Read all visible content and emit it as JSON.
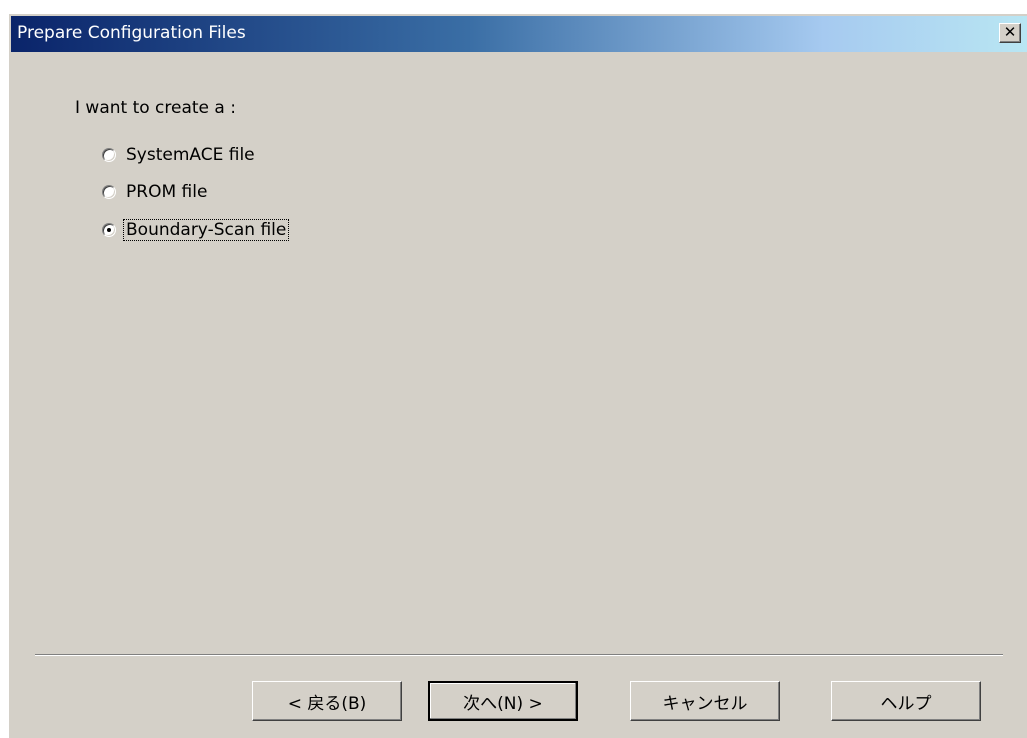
{
  "window": {
    "title": "Prepare Configuration Files",
    "close_glyph": "✕",
    "close_icon": "close-icon"
  },
  "main": {
    "prompt": "I want to create a :",
    "options": [
      {
        "label": "SystemACE file",
        "checked": false
      },
      {
        "label": "PROM file",
        "checked": false
      },
      {
        "label": "Boundary-Scan file",
        "checked": true
      }
    ]
  },
  "footer": {
    "back_label": "< 戻る(B)",
    "next_label": "次へ(N) >",
    "cancel_label": "キャンセル",
    "help_label": "ヘルプ"
  }
}
